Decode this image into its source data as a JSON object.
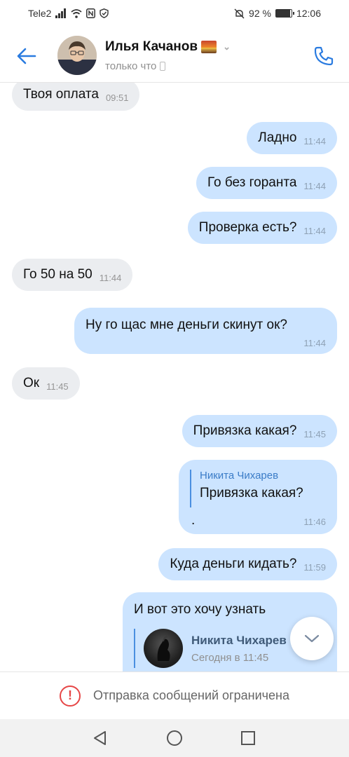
{
  "status_bar": {
    "carrier": "Tele2",
    "battery_percent_text": "92 %",
    "battery_level": 0.92,
    "time": "12:06"
  },
  "header": {
    "contact_name": "Илья Качанов",
    "status": "только что"
  },
  "messages": [
    {
      "dir": "in",
      "text": "Твоя оплата",
      "time": "09:51"
    },
    {
      "dir": "out",
      "text": "Ладно",
      "time": "11:44"
    },
    {
      "dir": "out",
      "text": "Го без горанта",
      "time": "11:44"
    },
    {
      "dir": "out",
      "text": "Проверка есть?",
      "time": "11:44"
    },
    {
      "dir": "in",
      "text": "Го 50 на 50",
      "time": "11:44"
    },
    {
      "dir": "out",
      "text": "Ну го щас мне деньги скинут ок?",
      "time": "11:44"
    },
    {
      "dir": "in",
      "text": "Ок",
      "time": "11:45"
    },
    {
      "dir": "out",
      "text": "Привязка какая?",
      "time": "11:45"
    },
    {
      "dir": "out",
      "reply_author": "Никита Чихарев",
      "reply_text": "Привязка какая?",
      "text": ".",
      "time": "11:46"
    },
    {
      "dir": "out",
      "text": "Куда деньги кидать?",
      "time": "11:59"
    },
    {
      "dir": "out",
      "text": "И вот это хочу узнать",
      "forward_name": "Никита Чихарев",
      "forward_date": "Сегодня в 11:45"
    }
  ],
  "footer": {
    "restricted_text": "Отправка сообщений ограничена"
  },
  "colors": {
    "accent": "#2a7be0",
    "outgoing_bubble": "#cce4ff",
    "incoming_bubble": "#ebedf0",
    "warning": "#e64646"
  }
}
